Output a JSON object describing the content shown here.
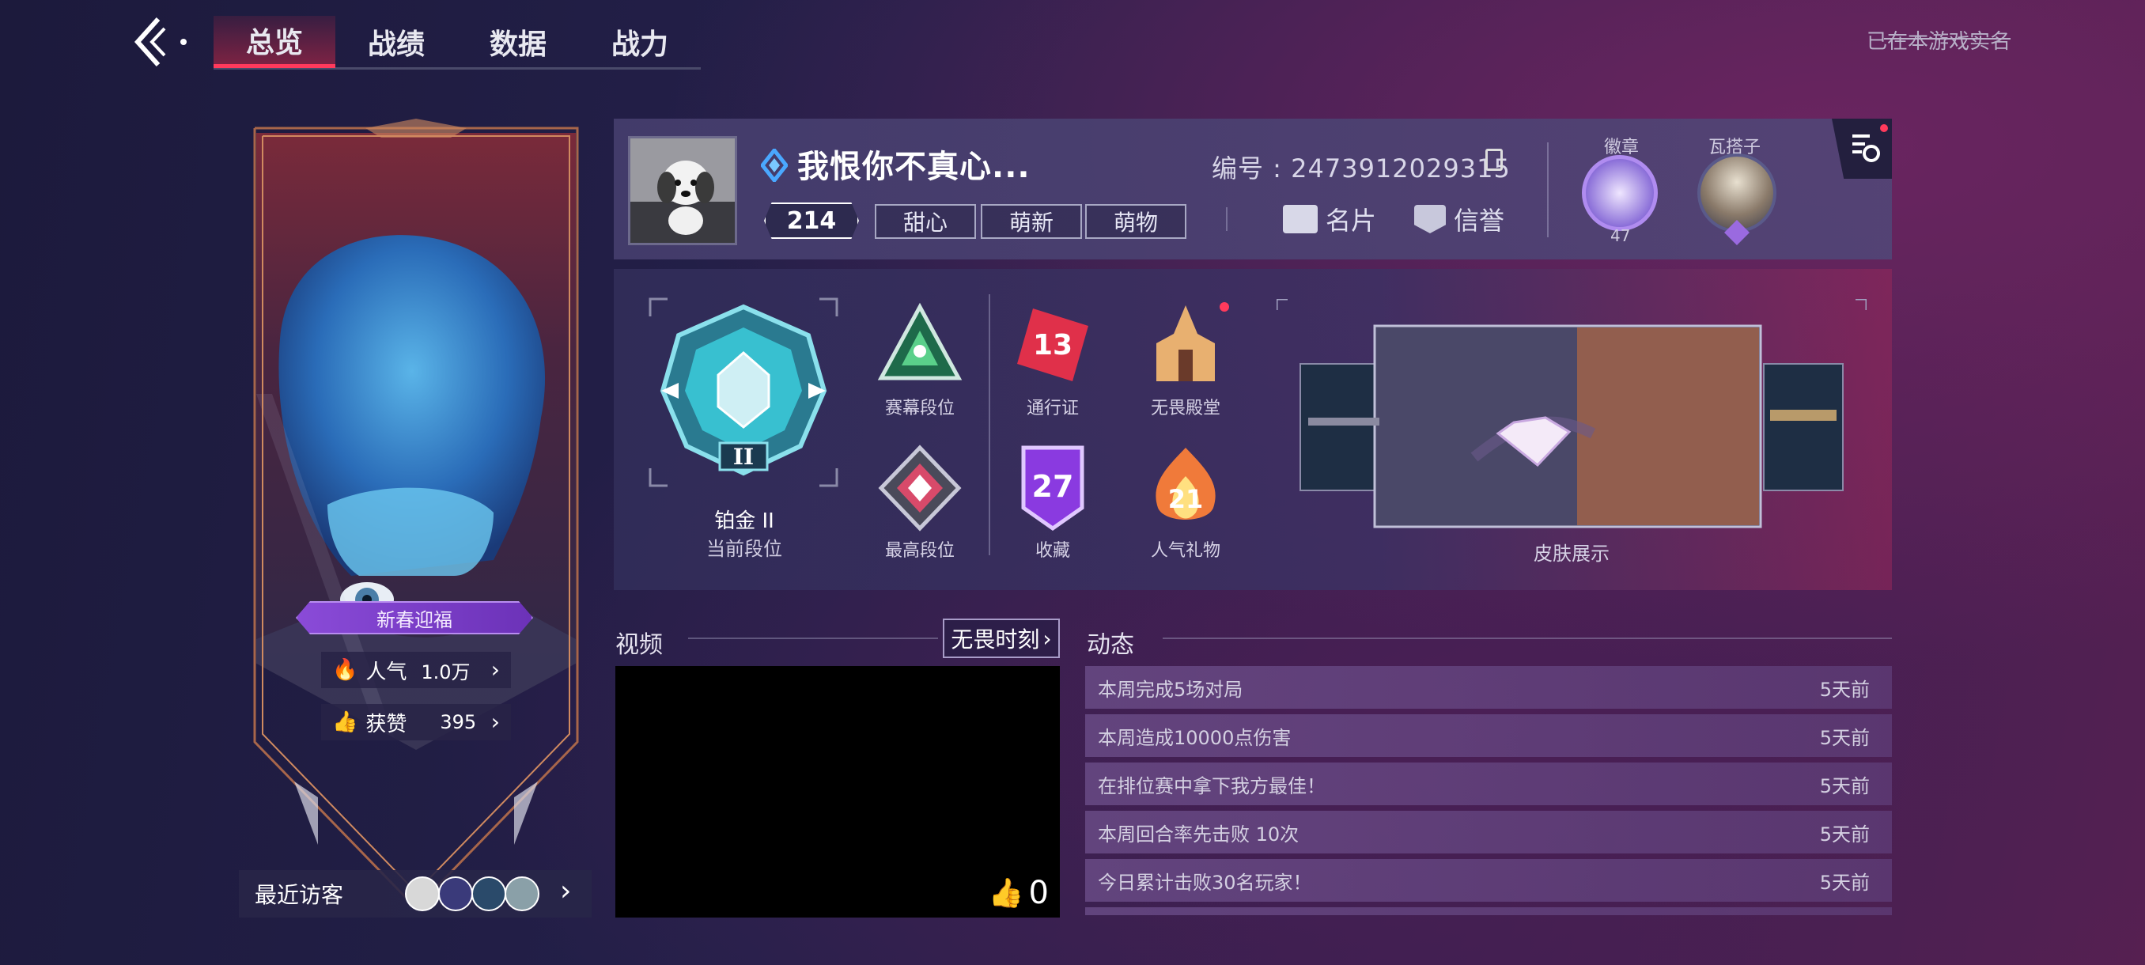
{
  "nav": {
    "tabs": [
      {
        "label": "总览",
        "active": true
      },
      {
        "label": "战绩",
        "active": false
      },
      {
        "label": "数据",
        "active": false
      },
      {
        "label": "战力",
        "active": false
      }
    ],
    "realname_status": "已在本游戏实名"
  },
  "card": {
    "event_banner": "新春迎福",
    "popularity_label": "人气",
    "popularity_value": "1.0万",
    "likes_label": "获赞",
    "likes_value": "395",
    "visitors_label": "最近访客"
  },
  "profile": {
    "name": "我恨你不真心...",
    "level": "214",
    "tags": [
      "甜心",
      "萌新",
      "萌物"
    ],
    "id_label": "编号 : 2473912029315",
    "card_label": "名片",
    "credit_label": "信誉",
    "badge_label": "徽章",
    "badge_count": "47",
    "pet_label": "瓦搭子"
  },
  "ranks": {
    "current_rank_name": "铂金 II",
    "current_rank_numeral": "II",
    "current_rank_label": "当前段位",
    "season_rank_label": "赛幕段位",
    "highest_rank_label": "最高段位",
    "pass_label": "通行证",
    "pass_value": "13",
    "hall_label": "无畏殿堂",
    "collection_label": "收藏",
    "collection_value": "27",
    "gift_label": "人气礼物",
    "gift_value": "21",
    "skin_label": "皮肤展示"
  },
  "video": {
    "title": "视频",
    "moment_button": "无畏时刻",
    "likes": "0"
  },
  "feed": {
    "title": "动态",
    "items": [
      {
        "text": "本周完成5场对局",
        "time": "5天前"
      },
      {
        "text": "本周造成10000点伤害",
        "time": "5天前"
      },
      {
        "text": "在排位赛中拿下我方最佳！",
        "time": "5天前"
      },
      {
        "text": "本周回合率先击败 10次",
        "time": "5天前"
      },
      {
        "text": "今日累计击败30名玩家！",
        "time": "5天前"
      }
    ]
  },
  "colors": {
    "accent_red": "#ff3a5c",
    "rank_teal": "#3fd0d8",
    "event_purple": "#8a4bd8"
  }
}
